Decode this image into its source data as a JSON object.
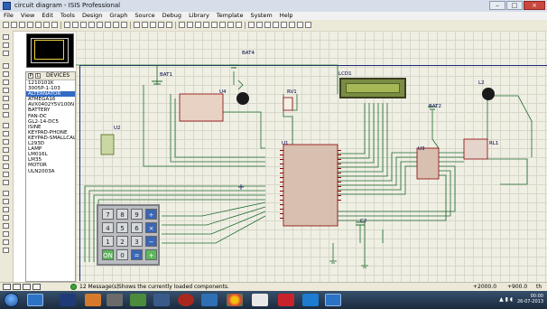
{
  "window": {
    "title": "circuit diagram - ISIS Professional",
    "minimize": "–",
    "maximize": "□",
    "close": "×"
  },
  "menu": [
    "File",
    "View",
    "Edit",
    "Tools",
    "Design",
    "Graph",
    "Source",
    "Debug",
    "Library",
    "Template",
    "System",
    "Help"
  ],
  "picker": {
    "tab_p": "P",
    "tab_l": "L",
    "label": "DEVICES",
    "devices": [
      "1210101K",
      "3005P-1-103",
      "ALTERNATOR",
      "ATMEGA16",
      "AVX0402Y5V100N",
      "BATTERY",
      "FAN-DC",
      "GL2-14-DC5",
      "ISINE",
      "KEYPAD-PHONE",
      "KEYPAD-SMALLCALC",
      "L293D",
      "LAMP",
      "LM016L",
      "LM35",
      "MOTOR",
      "ULN2003A"
    ],
    "selected": "ALTERNATOR"
  },
  "schematic": {
    "labels": {
      "bat1": "BAT1",
      "bat4": "BAT4",
      "lcd": "LCD1",
      "rv1": "RV1",
      "u4": "U4",
      "u2": "U2",
      "u1": "U1",
      "u3": "U3",
      "bat2": "BAT2",
      "l2": "L2",
      "rl1": "RL1",
      "c2": "C2"
    },
    "keypad_keys": [
      "7",
      "8",
      "9",
      "÷",
      "4",
      "5",
      "6",
      "×",
      "1",
      "2",
      "3",
      "−",
      "ON",
      "0",
      "=",
      "+"
    ]
  },
  "statusbar": {
    "messages": "12 Message(s)",
    "help": "Shows the currently loaded components.",
    "coord_x": "+2000.0",
    "coord_y": "+900.0",
    "unit": "th"
  },
  "taskbar": {
    "time": "00:00",
    "date": "26-07-2013"
  },
  "colors": {
    "wire": "#1e6b2e",
    "component_outline": "#8b0000",
    "ic_fill": "#d8c0b0",
    "sheet_border": "#1b2a7a",
    "selection_highlight": "#316ac5"
  }
}
